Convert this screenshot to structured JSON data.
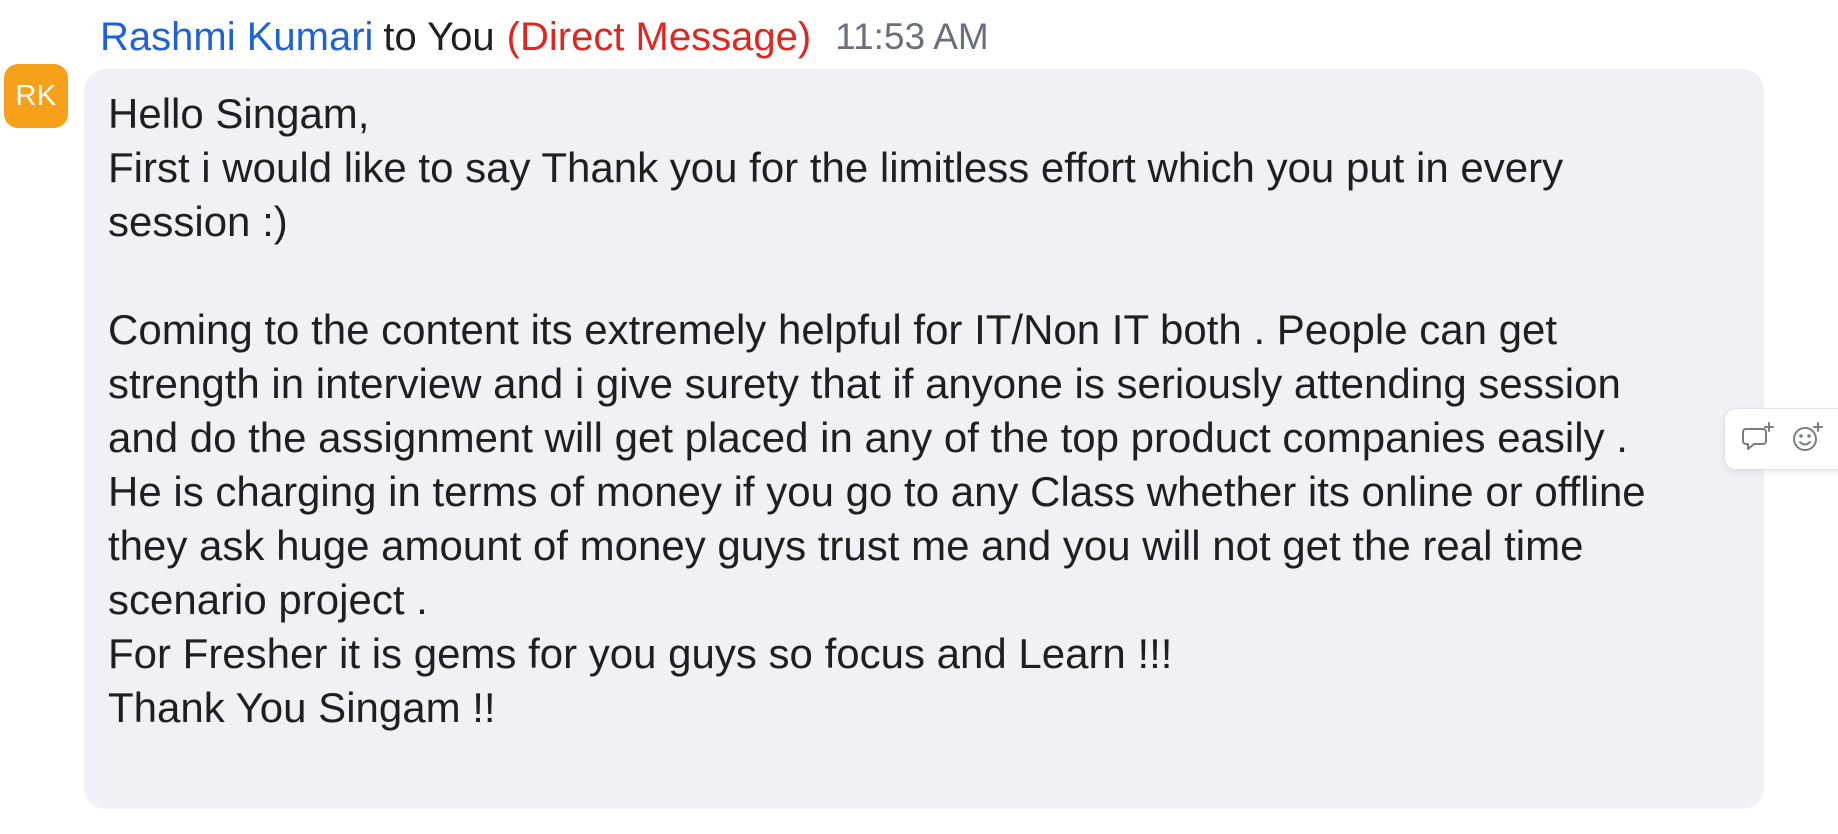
{
  "avatar": {
    "initials": "RK",
    "color": "#f7a01a"
  },
  "header": {
    "sender": "Rashmi Kumari",
    "to_label": "to You",
    "dm_label": "(Direct Message)",
    "timestamp": "11:53 AM"
  },
  "message": {
    "text": "Hello Singam,\nFirst i would like to say Thank you for the limitless effort which you put in every\nsession :)\n\nComing to the content its extremely helpful for IT/Non IT both . People can get\nstrength in interview and i give surety that if anyone is seriously attending session\nand do the assignment will get placed in any of the top product companies easily .\nHe is charging in terms of money if you go to any Class whether its online or offline\nthey ask huge amount of money guys trust me and you will not get the real time\nscenario project .\nFor Fresher it is gems for you guys so focus and Learn !!!\nThank You Singam !!"
  },
  "actions": {
    "reply_icon": "reply-thread-icon",
    "reaction_icon": "add-reaction-icon"
  },
  "colors": {
    "sender": "#1e63d6",
    "dm_label": "#e0271f",
    "bubble_bg": "#f0f0f5",
    "timestamp": "#6b6f7a"
  }
}
